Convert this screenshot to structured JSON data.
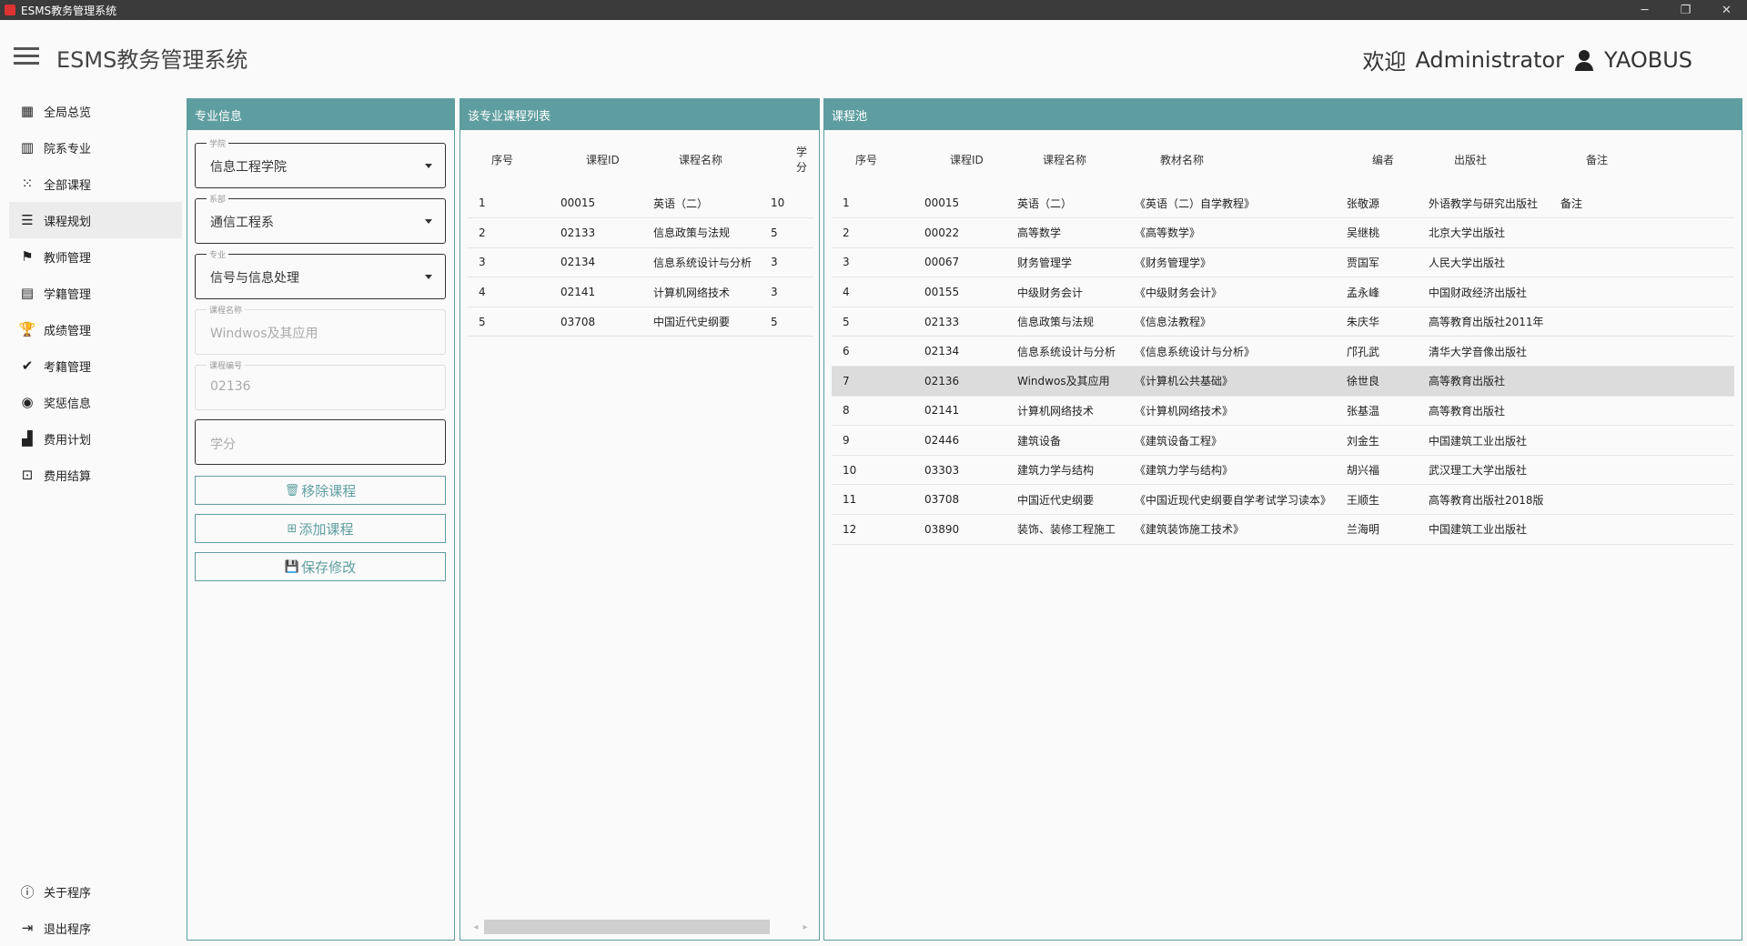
{
  "window": {
    "title": "ESMS教务管理系统",
    "minimize": "─",
    "maximize": "❐",
    "close": "✕"
  },
  "header": {
    "title": "ESMS教务管理系统",
    "welcome": "欢迎",
    "user": "Administrator",
    "account": "YAOBUS"
  },
  "sidebar": {
    "items": [
      {
        "label": "全局总览",
        "icon": "dashboard-icon",
        "glyph": "▦"
      },
      {
        "label": "院系专业",
        "icon": "building-icon",
        "glyph": "▥"
      },
      {
        "label": "全部课程",
        "icon": "grid-dots-icon",
        "glyph": "⁙"
      },
      {
        "label": "课程规划",
        "icon": "list-icon",
        "glyph": "☰"
      },
      {
        "label": "教师管理",
        "icon": "teacher-icon",
        "glyph": "⚑"
      },
      {
        "label": "学籍管理",
        "icon": "archive-icon",
        "glyph": "▤"
      },
      {
        "label": "成绩管理",
        "icon": "trophy-icon",
        "glyph": "🏆"
      },
      {
        "label": "考籍管理",
        "icon": "clipboard-check-icon",
        "glyph": "✔"
      },
      {
        "label": "奖惩信息",
        "icon": "award-icon",
        "glyph": "◉"
      },
      {
        "label": "费用计划",
        "icon": "chart-plus-icon",
        "glyph": "▟"
      },
      {
        "label": "费用结算",
        "icon": "cash-icon",
        "glyph": "⊡"
      }
    ],
    "active_index": 3,
    "bottom": [
      {
        "label": "关于程序",
        "icon": "info-icon",
        "glyph": "ⓘ"
      },
      {
        "label": "退出程序",
        "icon": "exit-icon",
        "glyph": "⇥"
      }
    ]
  },
  "major_panel": {
    "header": "专业信息",
    "college": {
      "label": "学院",
      "value": "信息工程学院"
    },
    "department": {
      "label": "系部",
      "value": "通信工程系"
    },
    "major": {
      "label": "专业",
      "value": "信号与信息处理"
    },
    "course_name": {
      "label": "课程名称",
      "value": "Windwos及其应用"
    },
    "course_code": {
      "label": "课程编号",
      "value": "02136"
    },
    "credit": {
      "placeholder": "学分"
    },
    "buttons": {
      "remove": {
        "label": "移除课程",
        "icon": "trash-icon",
        "glyph": "🗑"
      },
      "add": {
        "label": "添加课程",
        "icon": "plus-box-icon",
        "glyph": "⊞"
      },
      "save": {
        "label": "保存修改",
        "icon": "floppy-icon",
        "glyph": "💾"
      }
    }
  },
  "course_list": {
    "header": "该专业课程列表",
    "columns": [
      "序号",
      "课程ID",
      "课程名称",
      "学分"
    ],
    "rows": [
      [
        "1",
        "00015",
        "英语（二）",
        "10"
      ],
      [
        "2",
        "02133",
        "信息政策与法规",
        "5"
      ],
      [
        "3",
        "02134",
        "信息系统设计与分析",
        "3"
      ],
      [
        "4",
        "02141",
        "计算机网络技术",
        "3"
      ],
      [
        "5",
        "03708",
        "中国近代史纲要",
        "5"
      ]
    ],
    "scroll_left": "◂",
    "scroll_right": "▸"
  },
  "course_pool": {
    "header": "课程池",
    "columns": [
      "序号",
      "课程ID",
      "课程名称",
      "教材名称",
      "编者",
      "出版社",
      "备注"
    ],
    "rows": [
      [
        "1",
        "00015",
        "英语（二）",
        "《英语（二）自学教程》",
        "张敬源",
        "外语教学与研究出版社",
        "备注"
      ],
      [
        "2",
        "00022",
        "高等数学",
        "《高等数学》",
        "吴继桃",
        "北京大学出版社",
        ""
      ],
      [
        "3",
        "00067",
        "财务管理学",
        "《财务管理学》",
        "贾国军",
        "人民大学出版社",
        ""
      ],
      [
        "4",
        "00155",
        "中级财务会计",
        "《中级财务会计》",
        "孟永峰",
        "中国财政经济出版社",
        ""
      ],
      [
        "5",
        "02133",
        "信息政策与法规",
        "《信息法教程》",
        "朱庆华",
        "高等教育出版社2011年",
        ""
      ],
      [
        "6",
        "02134",
        "信息系统设计与分析",
        "《信息系统设计与分析》",
        "邝孔武",
        "清华大学音像出版社",
        ""
      ],
      [
        "7",
        "02136",
        "Windwos及其应用",
        "《计算机公共基础》",
        "徐世良",
        "高等教育出版社",
        ""
      ],
      [
        "8",
        "02141",
        "计算机网络技术",
        "《计算机网络技术》",
        "张基温",
        "高等教育出版社",
        ""
      ],
      [
        "9",
        "02446",
        "建筑设备",
        "《建筑设备工程》",
        "刘金生",
        "中国建筑工业出版社",
        ""
      ],
      [
        "10",
        "03303",
        "建筑力学与结构",
        "《建筑力学与结构》",
        "胡兴福",
        "武汉理工大学出版社",
        ""
      ],
      [
        "11",
        "03708",
        "中国近代史纲要",
        "《中国近现代史纲要自学考试学习读本》",
        "王顺生",
        "高等教育出版社2018版",
        ""
      ],
      [
        "12",
        "03890",
        "装饰、装修工程施工",
        "《建筑装饰施工技术》",
        "兰海明",
        "中国建筑工业出版社",
        ""
      ]
    ],
    "selected_index": 6
  },
  "colors": {
    "accent": "#5f9ea0",
    "titlebar": "#3b3b3b",
    "selected_row": "#dcdcdc"
  }
}
